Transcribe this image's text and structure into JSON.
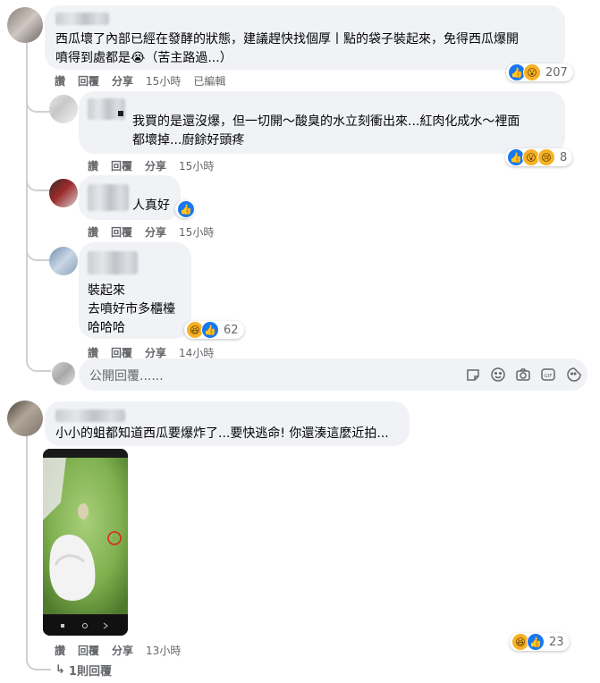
{
  "comments": [
    {
      "text": "西瓜壞了內部已經在發酵的狀態，建議趕快找個厚丨點的袋子裝起來，免得西瓜爆開\n噴得到處都是😭（苦主路過...）",
      "actions": {
        "like": "讚",
        "reply": "回覆",
        "share": "分享",
        "time": "15小時",
        "edited": "已編輯"
      },
      "reactions": {
        "icons": [
          "like-icon",
          "wow-icon"
        ],
        "count": "207"
      }
    },
    {
      "text": "我買的是還沒爆，但一切開～酸臭的水立刻衝出來...紅肉化成水～裡面\n都壞掉...廚餘好頭疼",
      "actions": {
        "like": "讚",
        "reply": "回覆",
        "share": "分享",
        "time": "15小時"
      },
      "reactions": {
        "icons": [
          "like-icon",
          "wow-icon",
          "sad-icon"
        ],
        "count": "8"
      }
    },
    {
      "text": "人真好",
      "actions": {
        "like": "讚",
        "reply": "回覆",
        "share": "分享",
        "time": "15小時"
      },
      "reactions": {
        "icons": [
          "like-icon"
        ],
        "count": ""
      }
    },
    {
      "text": "裝起來\n去噴好市多櫃檯\n哈哈哈",
      "actions": {
        "like": "讚",
        "reply": "回覆",
        "share": "分享",
        "time": "14小時"
      },
      "reactions": {
        "icons": [
          "haha-icon",
          "like-icon"
        ],
        "count": "62"
      }
    },
    {
      "text": "小小的蛆都知道西瓜要爆炸了...要快逃命! 你還湊這麼近拍...",
      "actions": {
        "like": "讚",
        "reply": "回覆",
        "share": "分享",
        "time": "13小時"
      },
      "reactions": {
        "icons": [
          "haha-icon",
          "like-icon"
        ],
        "count": "23"
      }
    }
  ],
  "reply_box": {
    "placeholder": "公開回覆......"
  },
  "view_replies": "1則回覆",
  "colors": {
    "bubble": "#f0f2f5",
    "meta": "#65676b",
    "like": "#1877f2",
    "emoji": "#f7b125"
  }
}
